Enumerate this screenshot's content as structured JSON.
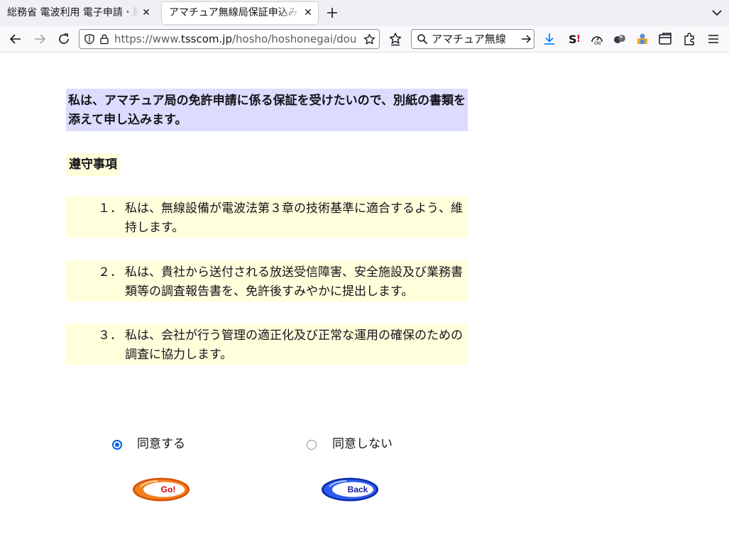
{
  "browser": {
    "tabs": [
      {
        "title": "総務省 電波利用 電子申請・届",
        "active": false
      },
      {
        "title": "アマチュア無線局保証申込み",
        "active": true
      }
    ],
    "url": {
      "prefix": "https://www.",
      "host": "tsscom.jp",
      "path": "/hosho/hoshonegai/dou"
    },
    "search_query": "アマチュア無線"
  },
  "page": {
    "intro": "私は、アマチュア局の免許申請に係る保証を受けたいので、別紙の書類を添えて申し込みます。",
    "heading": "遵守事項",
    "items": [
      {
        "num": "１．",
        "text": "私は、無線設備が電波法第３章の技術基準に適合するよう、維持します。"
      },
      {
        "num": "２．",
        "text": "私は、貴社から送付される放送受信障害、安全施設及び業務書類等の調査報告書を、免許後すみやかに提出します。"
      },
      {
        "num": "３．",
        "text": "私は、会社が行う管理の適正化及び正常な運用の確保のための調査に協力します。"
      }
    ],
    "agree_label": "同意する",
    "disagree_label": "同意しない",
    "agree_checked": true,
    "go_label": "Go!",
    "back_label": "Back"
  },
  "colors": {
    "intro_bg": "#dcdcff",
    "item_bg": "#ffffdc",
    "go_orange": "#e8660a",
    "back_blue": "#1d3fd0",
    "accent": "#0060df"
  }
}
